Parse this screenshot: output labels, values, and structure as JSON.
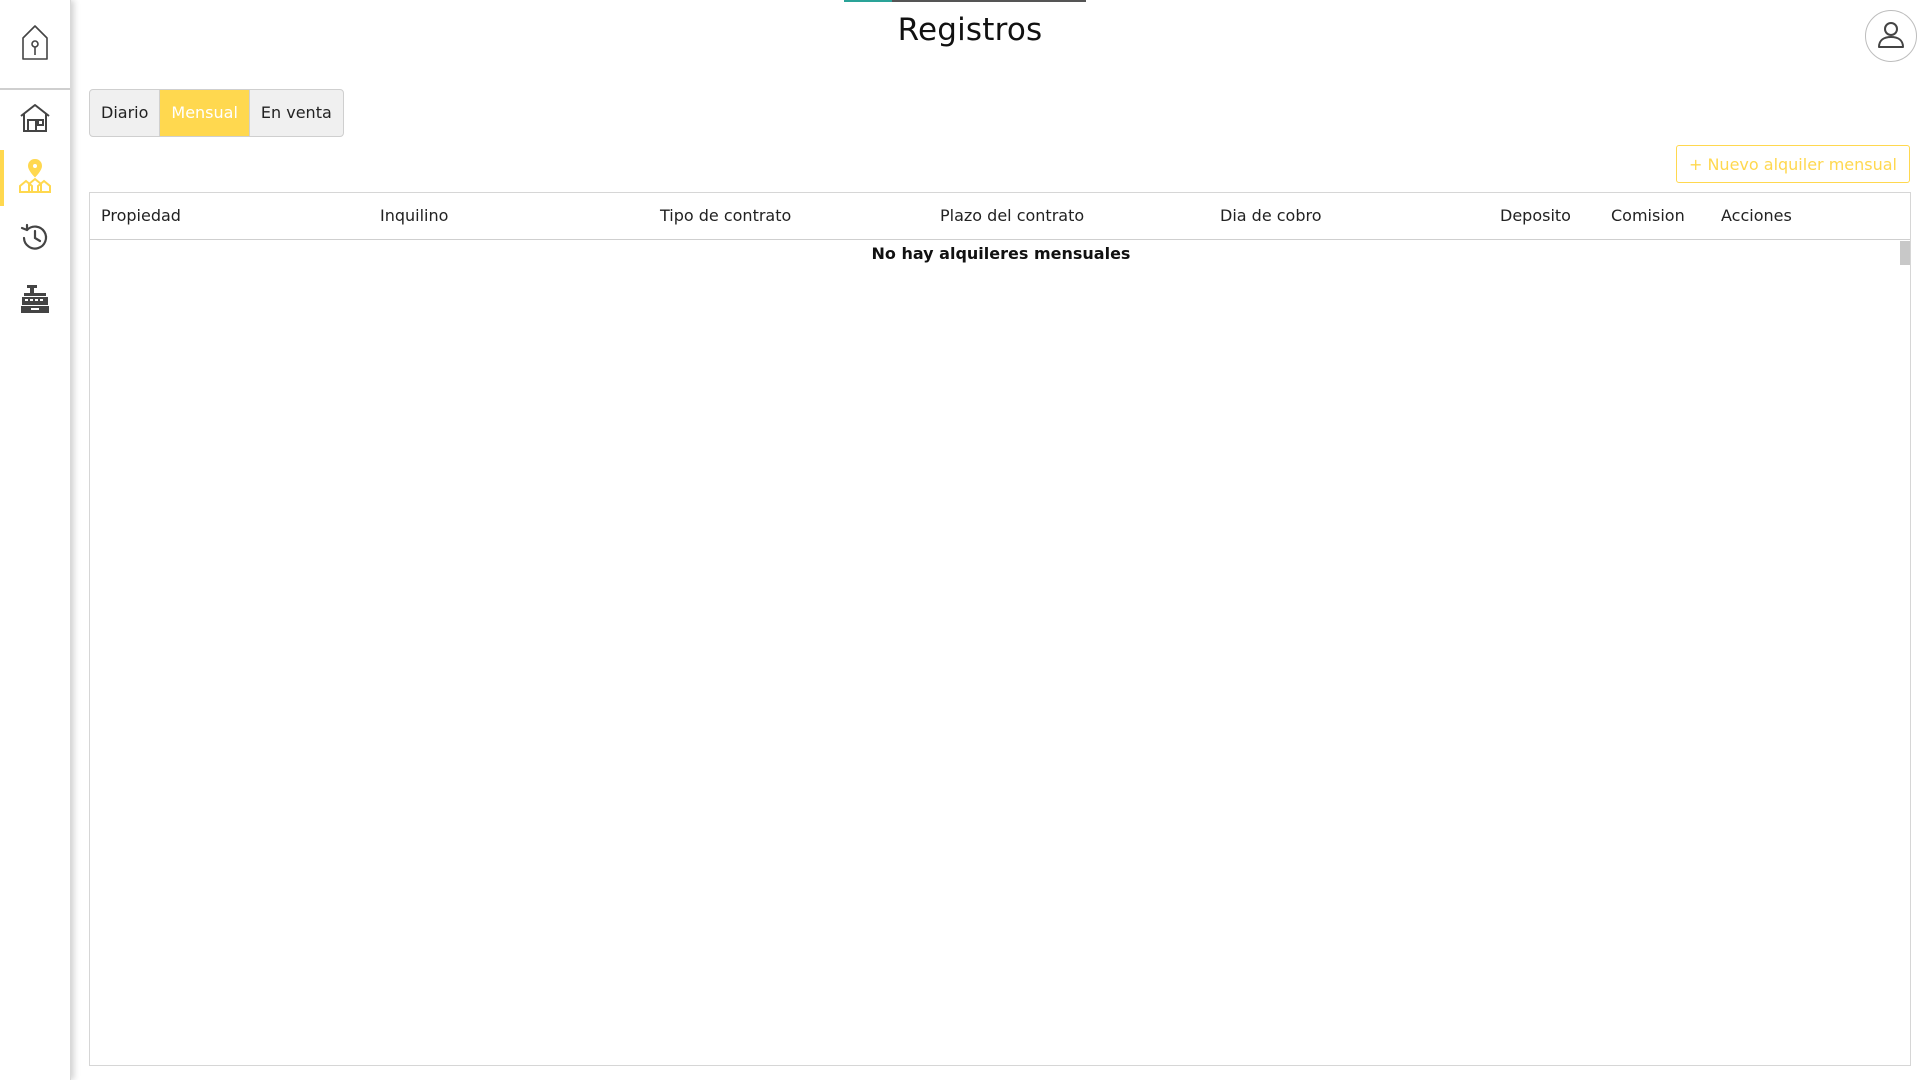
{
  "header": {
    "title": "Registros"
  },
  "sidebar": {
    "logo_icon": "house-key-icon",
    "items": [
      {
        "name": "home",
        "icon": "house-icon",
        "active": false
      },
      {
        "name": "rentals",
        "icon": "location-properties-icon",
        "active": true
      },
      {
        "name": "history",
        "icon": "history-icon",
        "active": false
      },
      {
        "name": "register",
        "icon": "cash-register-icon",
        "active": false
      }
    ]
  },
  "tabs": [
    {
      "label": "Diario",
      "active": false
    },
    {
      "label": "Mensual",
      "active": true
    },
    {
      "label": "En venta",
      "active": false
    }
  ],
  "actions": {
    "new_label": "+ Nuevo alquiler mensual"
  },
  "table": {
    "columns": [
      "Propiedad",
      "Inquilino",
      "Tipo de contrato",
      "Plazo del contrato",
      "Dia de cobro",
      "Deposito",
      "Comision",
      "Acciones"
    ],
    "rows": [],
    "empty_message": "No hay alquileres mensuales"
  },
  "colors": {
    "accent": "#ffd84f",
    "top_bar": "#555555",
    "top_bar_segment": "#2aa398"
  }
}
